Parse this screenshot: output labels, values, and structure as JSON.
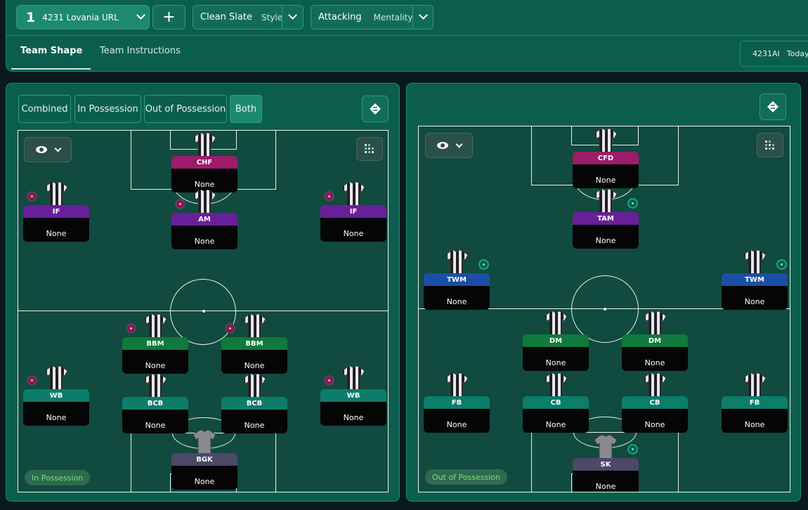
{
  "header": {
    "tactic_number": "1",
    "tactic_name": "4231 Lovania URL",
    "add_label": "+",
    "style_value": "Clean Slate",
    "style_label": "Style",
    "mentality_value": "Attacking",
    "mentality_label": "Mentality",
    "tabs": [
      "Team Shape",
      "Team Instructions"
    ],
    "active_tab": "Team Shape",
    "saved_name": "4231AI",
    "saved_date": "Today"
  },
  "left_panel": {
    "filters": [
      "Combined",
      "In Possession",
      "Out of Possession",
      "Both"
    ],
    "active_filter": "Both",
    "status_label": "In Possession"
  },
  "right_panel": {
    "status_label": "Out of Possession"
  },
  "colors": {
    "pink_role": "#9c1c6b",
    "purple_role": "#6a1f9a",
    "green_role": "#0f7a3c",
    "teal_role": "#0c7d6b",
    "blue_role": "#1b4fa6",
    "slate_role": "#4b4868",
    "shirt_stripe_dark": "#1f1f22",
    "shirt_stripe_light": "#e8e8ea",
    "keeper_shirt": "#8a8a8e"
  },
  "in_possession_players": [
    {
      "role": "CHF",
      "name": "None",
      "role_color": "pink",
      "badge": ""
    },
    {
      "role": "IF",
      "name": "None",
      "role_color": "purple",
      "badge": "pink"
    },
    {
      "role": "AM",
      "name": "None",
      "role_color": "purple",
      "badge": "pink"
    },
    {
      "role": "IF",
      "name": "None",
      "role_color": "purple",
      "badge": "pink"
    },
    {
      "role": "BBM",
      "name": "None",
      "role_color": "green",
      "badge": "pink"
    },
    {
      "role": "BBM",
      "name": "None",
      "role_color": "green",
      "badge": "pink"
    },
    {
      "role": "WB",
      "name": "None",
      "role_color": "teal",
      "badge": "pink"
    },
    {
      "role": "BCB",
      "name": "None",
      "role_color": "teal",
      "badge": ""
    },
    {
      "role": "BCB",
      "name": "None",
      "role_color": "teal",
      "badge": ""
    },
    {
      "role": "WB",
      "name": "None",
      "role_color": "teal",
      "badge": "pink"
    },
    {
      "role": "BGK",
      "name": "None",
      "role_color": "slate",
      "badge": "",
      "keeper": true
    }
  ],
  "out_of_possession_players": [
    {
      "role": "CFD",
      "name": "None",
      "role_color": "pink",
      "badge": ""
    },
    {
      "role": "TAM",
      "name": "None",
      "role_color": "purple",
      "badge": "teal"
    },
    {
      "role": "TWM",
      "name": "None",
      "role_color": "blue",
      "badge": "teal"
    },
    {
      "role": "TWM",
      "name": "None",
      "role_color": "blue",
      "badge": "teal"
    },
    {
      "role": "DM",
      "name": "None",
      "role_color": "green",
      "badge": ""
    },
    {
      "role": "DM",
      "name": "None",
      "role_color": "green",
      "badge": ""
    },
    {
      "role": "FB",
      "name": "None",
      "role_color": "teal",
      "badge": ""
    },
    {
      "role": "CB",
      "name": "None",
      "role_color": "teal",
      "badge": ""
    },
    {
      "role": "CB",
      "name": "None",
      "role_color": "teal",
      "badge": ""
    },
    {
      "role": "FB",
      "name": "None",
      "role_color": "teal",
      "badge": ""
    },
    {
      "role": "SK",
      "name": "None",
      "role_color": "slate",
      "badge": "teal",
      "keeper": true
    }
  ]
}
